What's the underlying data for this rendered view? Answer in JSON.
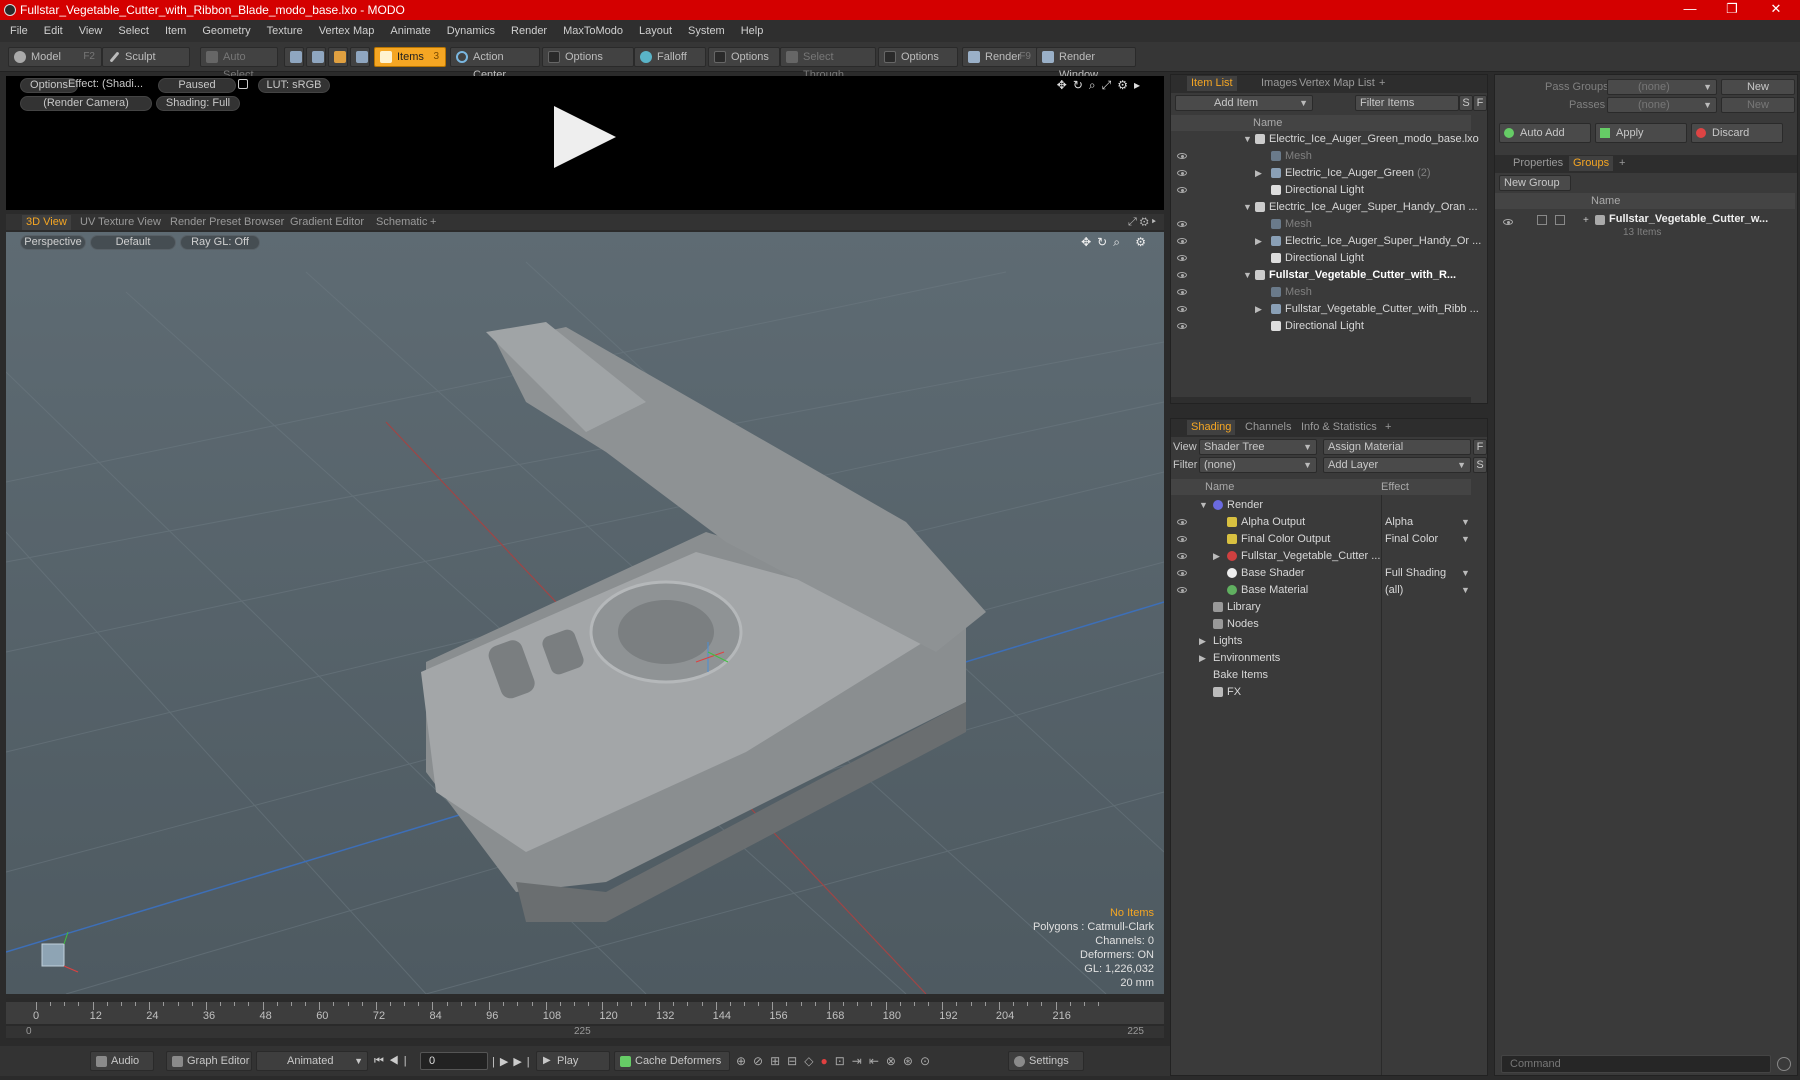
{
  "window": {
    "title": "Fullstar_Vegetable_Cutter_with_Ribbon_Blade_modo_base.lxo - MODO",
    "minimize": "—",
    "maximize": "❐",
    "close": "✕"
  },
  "menu": [
    "File",
    "Edit",
    "View",
    "Select",
    "Item",
    "Geometry",
    "Texture",
    "Vertex Map",
    "Animate",
    "Dynamics",
    "Render",
    "MaxToModo",
    "Layout",
    "System",
    "Help"
  ],
  "toolbar": {
    "model": "Model",
    "model_hotkey": "F2",
    "sculpt": "Sculpt",
    "auto_select": "Auto Select",
    "items": "Items",
    "items_badge": "3",
    "action_center": "Action Center",
    "options1": "Options",
    "falloff": "Falloff",
    "options2": "Options",
    "select_through": "Select Through",
    "options3": "Options",
    "render": "Render",
    "render_hotkey": "F9",
    "render_window": "Render Window"
  },
  "preview": {
    "options": "Options",
    "effect": "Effect: (Shadi...",
    "paused": "Paused",
    "lut": "LUT: sRGB",
    "camera": "(Render Camera)",
    "shading": "Shading: Full"
  },
  "view_tabs": [
    "3D View",
    "UV Texture View",
    "Render Preset Browser",
    "Gradient Editor",
    "Schematic"
  ],
  "viewport": {
    "perspective": "Perspective",
    "default": "Default",
    "raygl": "Ray GL: Off",
    "info": {
      "no_items": "No Items",
      "polygons": "Polygons : Catmull-Clark",
      "channels": "Channels: 0",
      "deformers": "Deformers: ON",
      "gl": "GL: 1,226,032",
      "size": "20 mm"
    }
  },
  "timeline": {
    "labels": [
      "0",
      "12",
      "24",
      "36",
      "48",
      "60",
      "72",
      "84",
      "96",
      "108",
      "120",
      "132",
      "144",
      "156",
      "168",
      "180",
      "192",
      "204",
      "216"
    ],
    "start": "0",
    "mid": "225",
    "end": "225"
  },
  "bottombar": {
    "audio": "Audio",
    "graph_editor": "Graph Editor",
    "animated": "Animated",
    "frame": "0",
    "play": "Play",
    "cache_deformers": "Cache Deformers",
    "settings": "Settings"
  },
  "item_list": {
    "tabs": [
      "Item List",
      "Images",
      "Vertex Map List"
    ],
    "add_item": "Add Item",
    "filter_items": "Filter Items",
    "s": "S",
    "f": "F",
    "col_name": "Name",
    "rows": [
      {
        "label": "Electric_Ice_Auger_Green_modo_base.lxo",
        "indent": 0,
        "type": "scene"
      },
      {
        "label": "Mesh",
        "indent": 1,
        "type": "mesh-dim"
      },
      {
        "label": "Electric_Ice_Auger_Green",
        "suffix": "(2)",
        "indent": 1,
        "type": "mesh"
      },
      {
        "label": "Directional Light",
        "indent": 1,
        "type": "light"
      },
      {
        "label": "Electric_Ice_Auger_Super_Handy_Oran ...",
        "indent": 0,
        "type": "scene"
      },
      {
        "label": "Mesh",
        "indent": 1,
        "type": "mesh-dim"
      },
      {
        "label": "Electric_Ice_Auger_Super_Handy_Or ...",
        "indent": 1,
        "type": "mesh"
      },
      {
        "label": "Directional Light",
        "indent": 1,
        "type": "light"
      },
      {
        "label": "Fullstar_Vegetable_Cutter_with_R...",
        "indent": 0,
        "type": "scene-bold"
      },
      {
        "label": "Mesh",
        "indent": 1,
        "type": "mesh-dim"
      },
      {
        "label": "Fullstar_Vegetable_Cutter_with_Ribb ...",
        "indent": 1,
        "type": "mesh"
      },
      {
        "label": "Directional Light",
        "indent": 1,
        "type": "light"
      }
    ]
  },
  "shading": {
    "tabs": [
      "Shading",
      "Channels",
      "Info & Statistics"
    ],
    "view_label": "View",
    "view_value": "Shader Tree",
    "assign_material": "Assign Material",
    "filter_label": "Filter",
    "filter_value": "(none)",
    "add_layer": "Add Layer",
    "f": "F",
    "s": "S",
    "col_name": "Name",
    "col_effect": "Effect",
    "rows": [
      {
        "label": "Render",
        "effect": "",
        "indent": 0
      },
      {
        "label": "Alpha Output",
        "effect": "Alpha",
        "indent": 1
      },
      {
        "label": "Final Color Output",
        "effect": "Final Color",
        "indent": 1
      },
      {
        "label": "Fullstar_Vegetable_Cutter ...",
        "effect": "",
        "indent": 1
      },
      {
        "label": "Base Shader",
        "effect": "Full Shading",
        "indent": 1
      },
      {
        "label": "Base Material",
        "effect": "(all)",
        "indent": 1
      },
      {
        "label": "Library",
        "effect": "",
        "indent": 0
      },
      {
        "label": "Nodes",
        "effect": "",
        "indent": 0
      },
      {
        "label": "Lights",
        "effect": "",
        "indent": 0
      },
      {
        "label": "Environments",
        "effect": "",
        "indent": 0
      },
      {
        "label": "Bake Items",
        "effect": "",
        "indent": 0
      },
      {
        "label": "FX",
        "effect": "",
        "indent": 0
      }
    ]
  },
  "groups": {
    "pass_groups": "Pass Groups",
    "pass_value": "(none)",
    "new": "New",
    "passes": "Passes",
    "passes_value": "(none)",
    "new2": "New",
    "auto_add": "Auto Add",
    "apply": "Apply",
    "discard": "Discard",
    "tabs": [
      "Properties",
      "Groups"
    ],
    "new_group": "New Group",
    "col_name": "Name",
    "item_name": "Fullstar_Vegetable_Cutter_w...",
    "item_count": "13 Items"
  },
  "command": {
    "placeholder": "Command"
  }
}
